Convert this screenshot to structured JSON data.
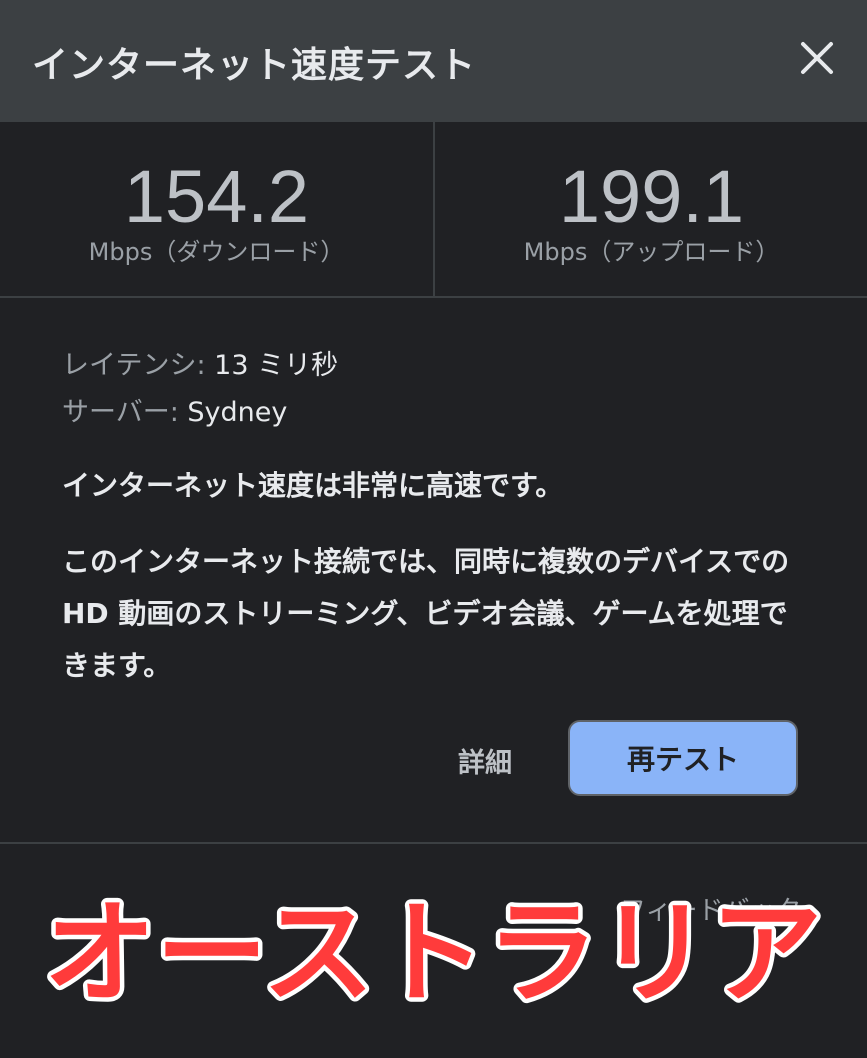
{
  "dialog": {
    "title": "インターネット速度テスト"
  },
  "metrics": {
    "download": {
      "value": "154.2",
      "unit": "Mbps（ダウンロード）"
    },
    "upload": {
      "value": "199.1",
      "unit": "Mbps（アップロード）"
    }
  },
  "info": {
    "latency_label": "レイテンシ:",
    "latency_value": "13 ミリ秒",
    "server_label": "サーバー:",
    "server_value": "Sydney"
  },
  "verdict": "インターネット速度は非常に高速です。",
  "description": "このインターネット接続では、同時に複数のデバイスでの HD 動画のストリーミング、ビデオ会議、ゲームを処理できます。",
  "buttons": {
    "details_label": "詳細",
    "retest_label": "再テスト"
  },
  "feedback_label": "フィードバック",
  "overlay_caption": "オーストラリア",
  "colors": {
    "background": "#202124",
    "header": "#3c4043",
    "accent_button": "#8ab4f8",
    "overlay_text": "#ff3b3b"
  },
  "icons": {
    "close": "close-icon"
  }
}
